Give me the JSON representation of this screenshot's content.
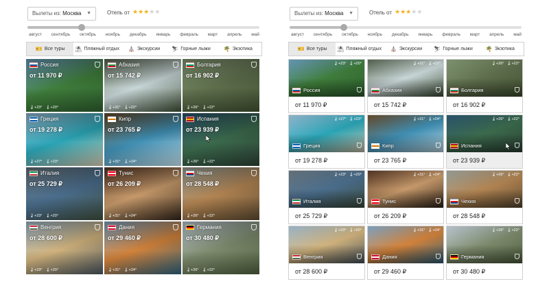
{
  "filters": {
    "departure_label": "Вылеты из:",
    "departure_value": "Москва",
    "hotel_label": "Отель от",
    "stars_on": 3,
    "stars_total": 5
  },
  "slider": {
    "months": [
      "август",
      "сентябрь",
      "октябрь",
      "ноябрь",
      "декабрь",
      "январь",
      "февраль",
      "март",
      "апрель",
      "май"
    ],
    "selected_month": "октябрь"
  },
  "tabs": [
    {
      "label": "Все туры",
      "icon": "tickets-icon",
      "active": true
    },
    {
      "label": "Пляжный отдых",
      "icon": "beach-icon",
      "active": false
    },
    {
      "label": "Экскурсии",
      "icon": "landmark-icon",
      "active": false
    },
    {
      "label": "Горные лыжи",
      "icon": "skier-icon",
      "active": false
    },
    {
      "label": "Экзотика",
      "icon": "palm-icon",
      "active": false
    }
  ],
  "destinations": [
    {
      "name": "Россия",
      "price": "от 11 970 ₽",
      "day": "+23°",
      "night": "+20°",
      "flag": [
        "#ffffff",
        "#1c57a5",
        "#d52b1e"
      ],
      "photo": [
        "#6fa3c7",
        "#3f7d3a",
        "#2c5a2d"
      ]
    },
    {
      "name": "Абхазия",
      "price": "от 15 742 ₽",
      "day": "+31°",
      "night": "+22°",
      "flag": [
        "#ffffff",
        "#2d8f3c",
        "#c8102e"
      ],
      "photo": [
        "#5c6a55",
        "#c9d7d8",
        "#3a4a32"
      ]
    },
    {
      "name": "Болгария",
      "price": "от 16 902 ₽",
      "day": "+26°",
      "night": "+22°",
      "flag": [
        "#ffffff",
        "#00966e",
        "#d62612"
      ],
      "photo": [
        "#8aa07a",
        "#5e6e4c",
        "#3d4c2e"
      ]
    },
    {
      "name": "Греция",
      "price": "от 19 278 ₽",
      "day": "+27°",
      "night": "+23°",
      "flag": [
        "#0d5eaf",
        "#ffffff",
        "#0d5eaf"
      ],
      "photo": [
        "#9cc4dd",
        "#2aa5b6",
        "#c8c0a8"
      ]
    },
    {
      "name": "Кипр",
      "price": "от 23 765 ₽",
      "day": "+31°",
      "night": "+24°",
      "flag": [
        "#ffffff",
        "#d57800",
        "#ffffff"
      ],
      "photo": [
        "#6d5030",
        "#3f8fb4",
        "#b8d5e0"
      ]
    },
    {
      "name": "Испания",
      "price": "от 23 939 ₽",
      "day": "+26°",
      "night": "+22°",
      "flag": [
        "#aa151b",
        "#f1bf00",
        "#aa151b"
      ],
      "photo": [
        "#2e5a74",
        "#3b6a4c",
        "#2a3e33"
      ]
    },
    {
      "name": "Италия",
      "price": "от 25 729 ₽",
      "day": "+23°",
      "night": "+20°",
      "flag": [
        "#009246",
        "#ffffff",
        "#ce2b37"
      ],
      "photo": [
        "#6d7c85",
        "#4a6d8c",
        "#3b4a3a"
      ]
    },
    {
      "name": "Тунис",
      "price": "от 26 209 ₽",
      "day": "+31°",
      "night": "+24°",
      "flag": [
        "#e70013",
        "#ffffff",
        "#e70013"
      ],
      "photo": [
        "#5a3a28",
        "#c79a6b",
        "#2e2218"
      ]
    },
    {
      "name": "Чехия",
      "price": "от 28 548 ₽",
      "day": "+26°",
      "night": "+22°",
      "flag": [
        "#ffffff",
        "#d7141a",
        "#11457e"
      ],
      "photo": [
        "#a2a9a1",
        "#b28452",
        "#56452e"
      ]
    },
    {
      "name": "Венгрия",
      "price": "от 28 600 ₽",
      "day": "+23°",
      "night": "+20°",
      "flag": [
        "#ce2939",
        "#ffffff",
        "#477050"
      ],
      "photo": [
        "#a9c4d9",
        "#d0b27c",
        "#44505a"
      ]
    },
    {
      "name": "Дания",
      "price": "от 29 460 ₽",
      "day": "+31°",
      "night": "+24°",
      "flag": [
        "#c8102e",
        "#ffffff",
        "#c8102e"
      ],
      "photo": [
        "#8ab0cf",
        "#d2823a",
        "#2b5e78"
      ]
    },
    {
      "name": "Германия",
      "price": "от 30 480 ₽",
      "day": "+26°",
      "night": "+22°",
      "flag": [
        "#000000",
        "#dd0000",
        "#ffce00"
      ],
      "photo": [
        "#c8d6e0",
        "#7d8a6c",
        "#4a5a3a"
      ]
    }
  ],
  "hovered_destination": "Испания"
}
